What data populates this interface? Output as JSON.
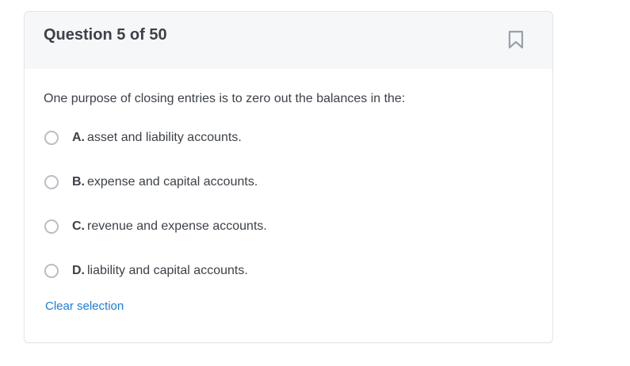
{
  "header": {
    "title": "Question 5 of 50",
    "bookmark_icon": "bookmark-icon"
  },
  "question": {
    "text": "One purpose of closing entries is to zero out the balances in the:"
  },
  "options": [
    {
      "letter": "A.",
      "text": "asset and liability accounts."
    },
    {
      "letter": "B.",
      "text": "expense and capital accounts."
    },
    {
      "letter": "C.",
      "text": "revenue and expense accounts."
    },
    {
      "letter": "D.",
      "text": "liability and capital accounts."
    }
  ],
  "actions": {
    "clear_label": "Clear selection"
  },
  "colors": {
    "header_bg": "#f6f7f9",
    "text": "#3d4248",
    "link": "#1e7dd6",
    "radio_border": "#b9bec4"
  }
}
